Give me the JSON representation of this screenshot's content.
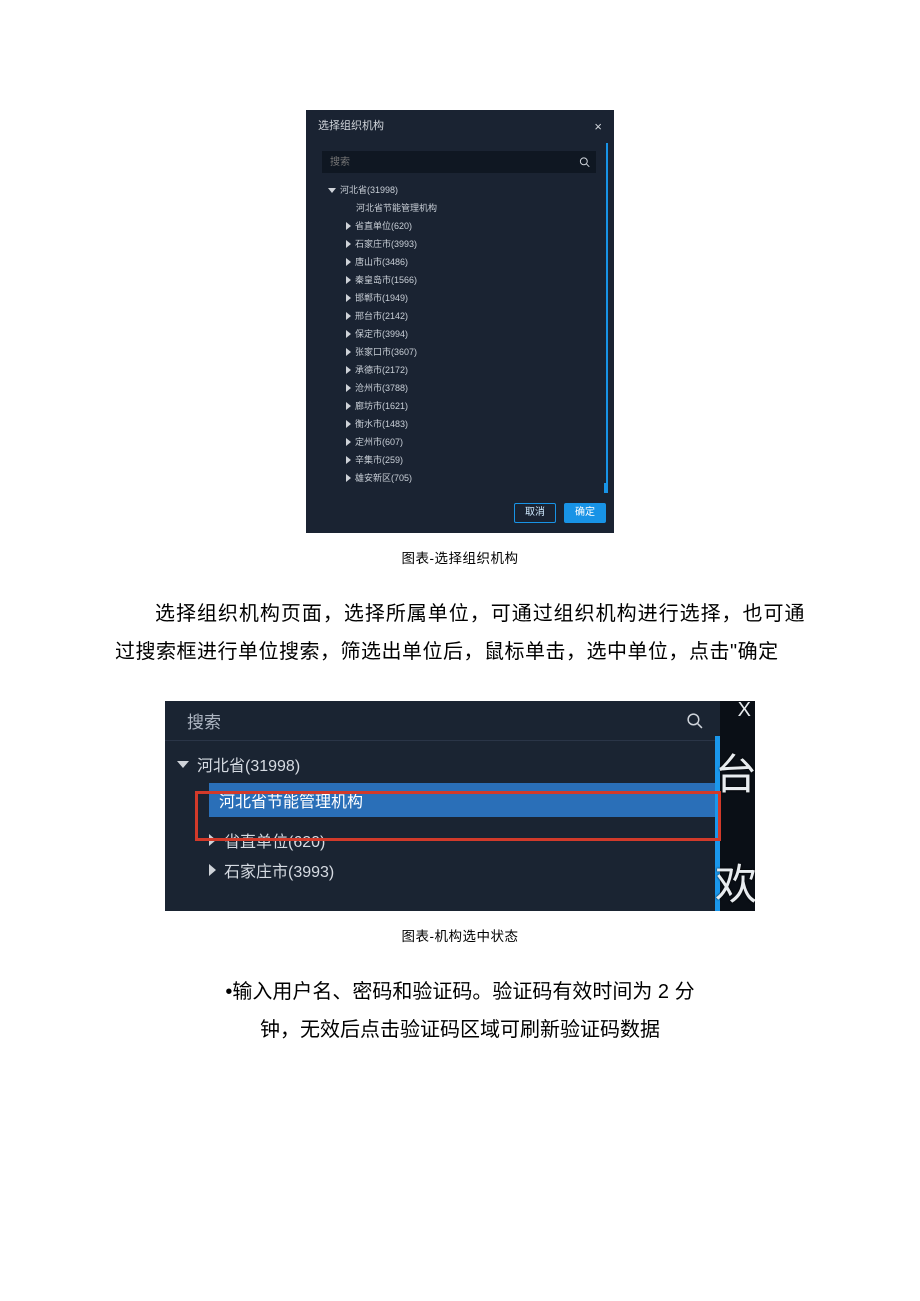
{
  "fig1": {
    "title": "选择组织机构",
    "search_placeholder": "搜索",
    "root_label": "河北省(31998)",
    "child_selected": "河北省节能管理机构",
    "items": [
      "省直单位(620)",
      "石家庄市(3993)",
      "唐山市(3486)",
      "秦皇岛市(1566)",
      "邯郸市(1949)",
      "邢台市(2142)",
      "保定市(3994)",
      "张家口市(3607)",
      "承德市(2172)",
      "沧州市(3788)",
      "廊坊市(1621)",
      "衡水市(1483)",
      "定州市(607)",
      "辛集市(259)",
      "雄安新区(705)"
    ],
    "cancel": "取消",
    "confirm": "确定"
  },
  "caption1": "图表-选择组织机构",
  "para1": "选择组织机构页面，选择所属单位，可通过组织机构进行选择，也可通过搜索框进行单位搜索，筛选出单位后，鼠标单击，选中单位，点击\"确定",
  "fig2": {
    "close": "X",
    "search_placeholder": "搜索",
    "root_label": "河北省(31998)",
    "selected": "河北省节能管理机构",
    "items": [
      "省直单位(620)",
      "石家庄市(3993)"
    ],
    "side_char_top": "台",
    "side_char_bottom": "欢"
  },
  "caption2": "图表-机构选中状态",
  "bullet_line1": "•输入用户名、密码和验证码。验证码有效时间为 2 分",
  "bullet_line2": "钟，无效后点击验证码区域可刷新验证码数据"
}
